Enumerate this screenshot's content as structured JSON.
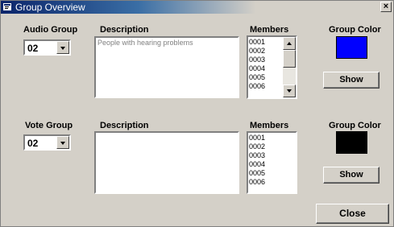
{
  "window": {
    "title": "Group Overview",
    "close_glyph": "×"
  },
  "audio_group": {
    "label": "Audio Group",
    "value": "02",
    "description_label": "Description",
    "description_text": "People with hearing problems",
    "members_label": "Members",
    "members": [
      "0001",
      "0002",
      "0003",
      "0004",
      "0005",
      "0006"
    ],
    "color_label": "Group Color",
    "color": "#0000ff",
    "show_label": "Show"
  },
  "vote_group": {
    "label": "Vote Group",
    "value": "02",
    "description_label": "Description",
    "description_text": "",
    "members_label": "Members",
    "members": [
      "0001",
      "0002",
      "0003",
      "0004",
      "0005",
      "0006"
    ],
    "color_label": "Group Color",
    "color": "#000000",
    "show_label": "Show"
  },
  "close_label": "Close",
  "icons": {
    "title": "window-app-icon",
    "dropdown": "chevron-down-icon",
    "scroll_up": "scroll-up-icon",
    "scroll_down": "scroll-down-icon"
  }
}
